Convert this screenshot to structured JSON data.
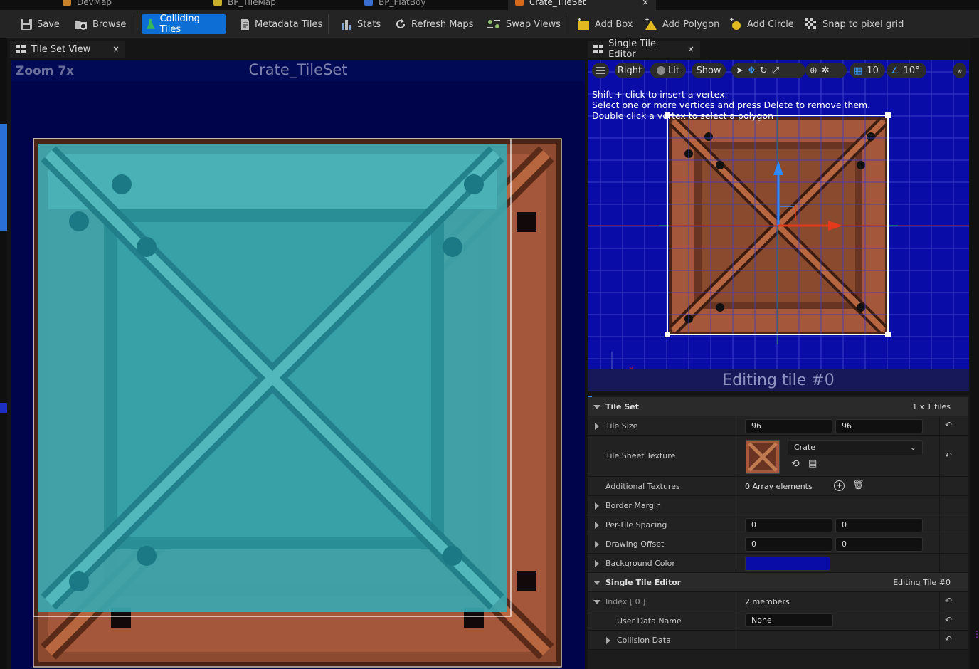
{
  "doc_tabs": [
    {
      "label": "DevMap",
      "color": "#c8832a"
    },
    {
      "label": "BP_TileMap",
      "color": "#c8b02a"
    },
    {
      "label": "BP_FlatBoy",
      "color": "#3a6fd1"
    },
    {
      "label": "Crate_TileSet",
      "color": "#d66a1a",
      "active": true,
      "close": "×"
    }
  ],
  "toolbar": {
    "save": "Save",
    "browse": "Browse",
    "colliding_tiles": "Colliding Tiles",
    "metadata_tiles": "Metadata Tiles",
    "stats": "Stats",
    "refresh_maps": "Refresh Maps",
    "swap_views": "Swap Views",
    "add_box": "Add Box",
    "add_polygon": "Add Polygon",
    "add_circle": "Add Circle",
    "snap_to_pixel_grid": "Snap to pixel grid"
  },
  "left_panel": {
    "tab_title": "Tile Set View",
    "close": "×",
    "zoom_label": "Zoom 7x",
    "asset_title": "Crate_TileSet"
  },
  "right_panel": {
    "tab_title": "Single Tile Editor",
    "close": "×",
    "view_mode": "Right",
    "lit": "Lit",
    "show": "Show",
    "grid_size": "10",
    "rotation_snap": "10°",
    "hint_line1": "Shift + click to insert a vertex.",
    "hint_line2": "Select one or more vertices and press Delete to remove them.",
    "hint_line3": "Double click a vertex to select a polygon",
    "editing_banner": "Editing tile #0",
    "axis_x": "x"
  },
  "details": {
    "tile_set": {
      "header": "Tile Set",
      "summary": "1 x 1 tiles",
      "tile_size_label": "Tile Size",
      "tile_size_x": "96",
      "tile_size_y": "96",
      "tile_sheet_texture_label": "Tile Sheet Texture",
      "tile_sheet_texture_value": "Crate",
      "additional_textures_label": "Additional Textures",
      "additional_textures_value": "0 Array elements",
      "border_margin_label": "Border Margin",
      "per_tile_spacing_label": "Per-Tile Spacing",
      "per_tile_spacing_x": "0",
      "per_tile_spacing_y": "0",
      "drawing_offset_label": "Drawing Offset",
      "drawing_offset_x": "0",
      "drawing_offset_y": "0",
      "background_color_label": "Background Color",
      "background_color": "#0a0ca8"
    },
    "single_tile_editor": {
      "header": "Single Tile Editor",
      "summary": "Editing Tile #0",
      "index_label": "Index [ 0 ]",
      "index_value": "2 members",
      "user_data_name_label": "User Data Name",
      "user_data_name_value": "None",
      "collision_data_label": "Collision Data"
    }
  },
  "colors": {
    "accent": "#0d6fd6",
    "left_viewport_bg": "#00054b",
    "collision_overlay": "#3aa7ae",
    "crate_brown": "#a45a3a"
  }
}
